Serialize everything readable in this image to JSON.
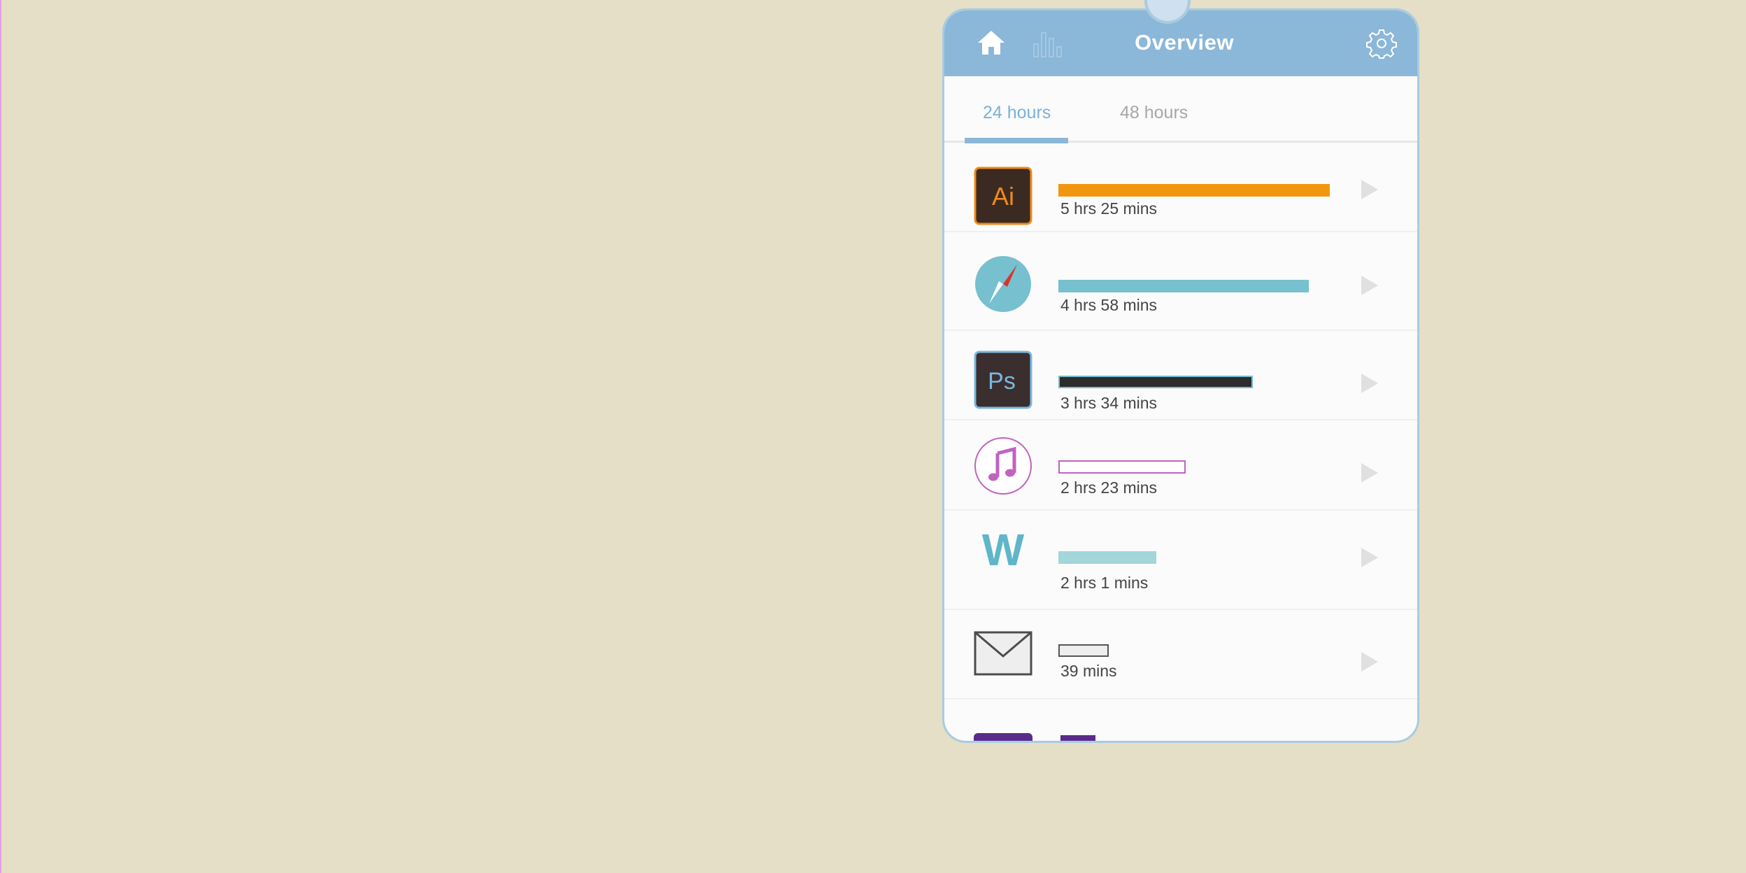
{
  "header": {
    "title": "Overview",
    "icons": [
      "home-icon",
      "bar-chart-icon",
      "gear-icon"
    ],
    "color": "#8bb7d9"
  },
  "tabs": [
    {
      "label": "24 hours",
      "active": true
    },
    {
      "label": "48 hours",
      "active": false
    }
  ],
  "apps": [
    {
      "icon": "adobe-illustrator-icon",
      "icon_text": "Ai",
      "duration": "5 hrs 25 mins",
      "usage_fraction": 1.0,
      "bar_color": "#f2960f"
    },
    {
      "icon": "safari-compass-icon",
      "icon_text": "",
      "duration": "4 hrs 58 mins",
      "usage_fraction": 0.92,
      "bar_color": "#76c0cf"
    },
    {
      "icon": "adobe-photoshop-icon",
      "icon_text": "Ps",
      "duration": "3 hrs 34 mins",
      "usage_fraction": 0.72,
      "bar_color": "#2e2c2c"
    },
    {
      "icon": "music-note-icon",
      "icon_text": "",
      "duration": "2 hrs 23 mins",
      "usage_fraction": 0.47,
      "bar_color": "#c063c0"
    },
    {
      "icon": "word-w-icon",
      "icon_text": "W",
      "duration": "2 hrs 1 mins",
      "usage_fraction": 0.36,
      "bar_color": "#a2d6d8"
    },
    {
      "icon": "mail-envelope-icon",
      "icon_text": "",
      "duration": "39 mins",
      "usage_fraction": 0.19,
      "bar_color": "#555555"
    }
  ]
}
